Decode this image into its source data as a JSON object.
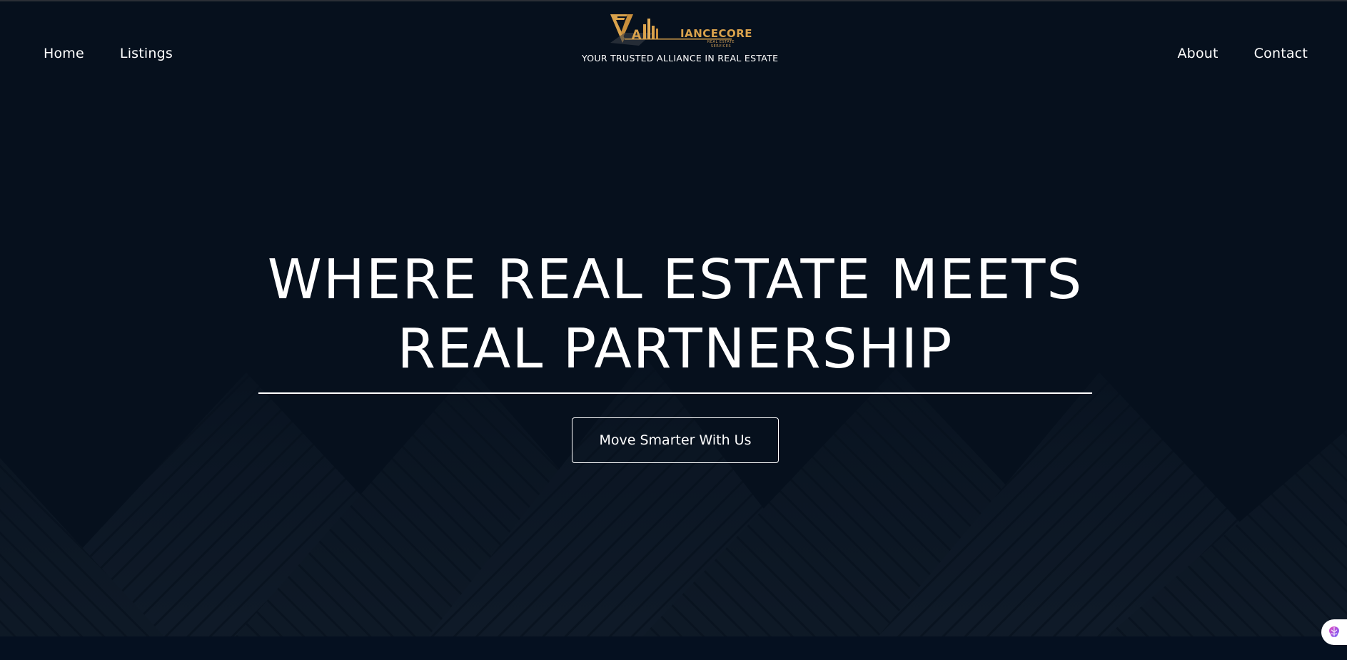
{
  "header": {
    "nav_left": [
      {
        "label": "Home"
      },
      {
        "label": "Listings"
      }
    ],
    "nav_right": [
      {
        "label": "About"
      },
      {
        "label": "Contact"
      }
    ],
    "brand": {
      "logo_letter": "A",
      "logo_word": "IANCECORE",
      "logo_sub": "REAL ESTATE SERVICES",
      "tagline": "YOUR TRUSTED ALLIANCE IN REAL ESTATE"
    }
  },
  "hero": {
    "title_line1": "WHERE REAL ESTATE MEETS",
    "title_line2": "REAL PARTNERSHIP",
    "cta_label": "Move Smarter With Us"
  },
  "colors": {
    "background": "#06101d",
    "text": "#ffffff",
    "logo_gold": "#d9a24c"
  },
  "icons": {
    "assistant": "brain-icon"
  }
}
